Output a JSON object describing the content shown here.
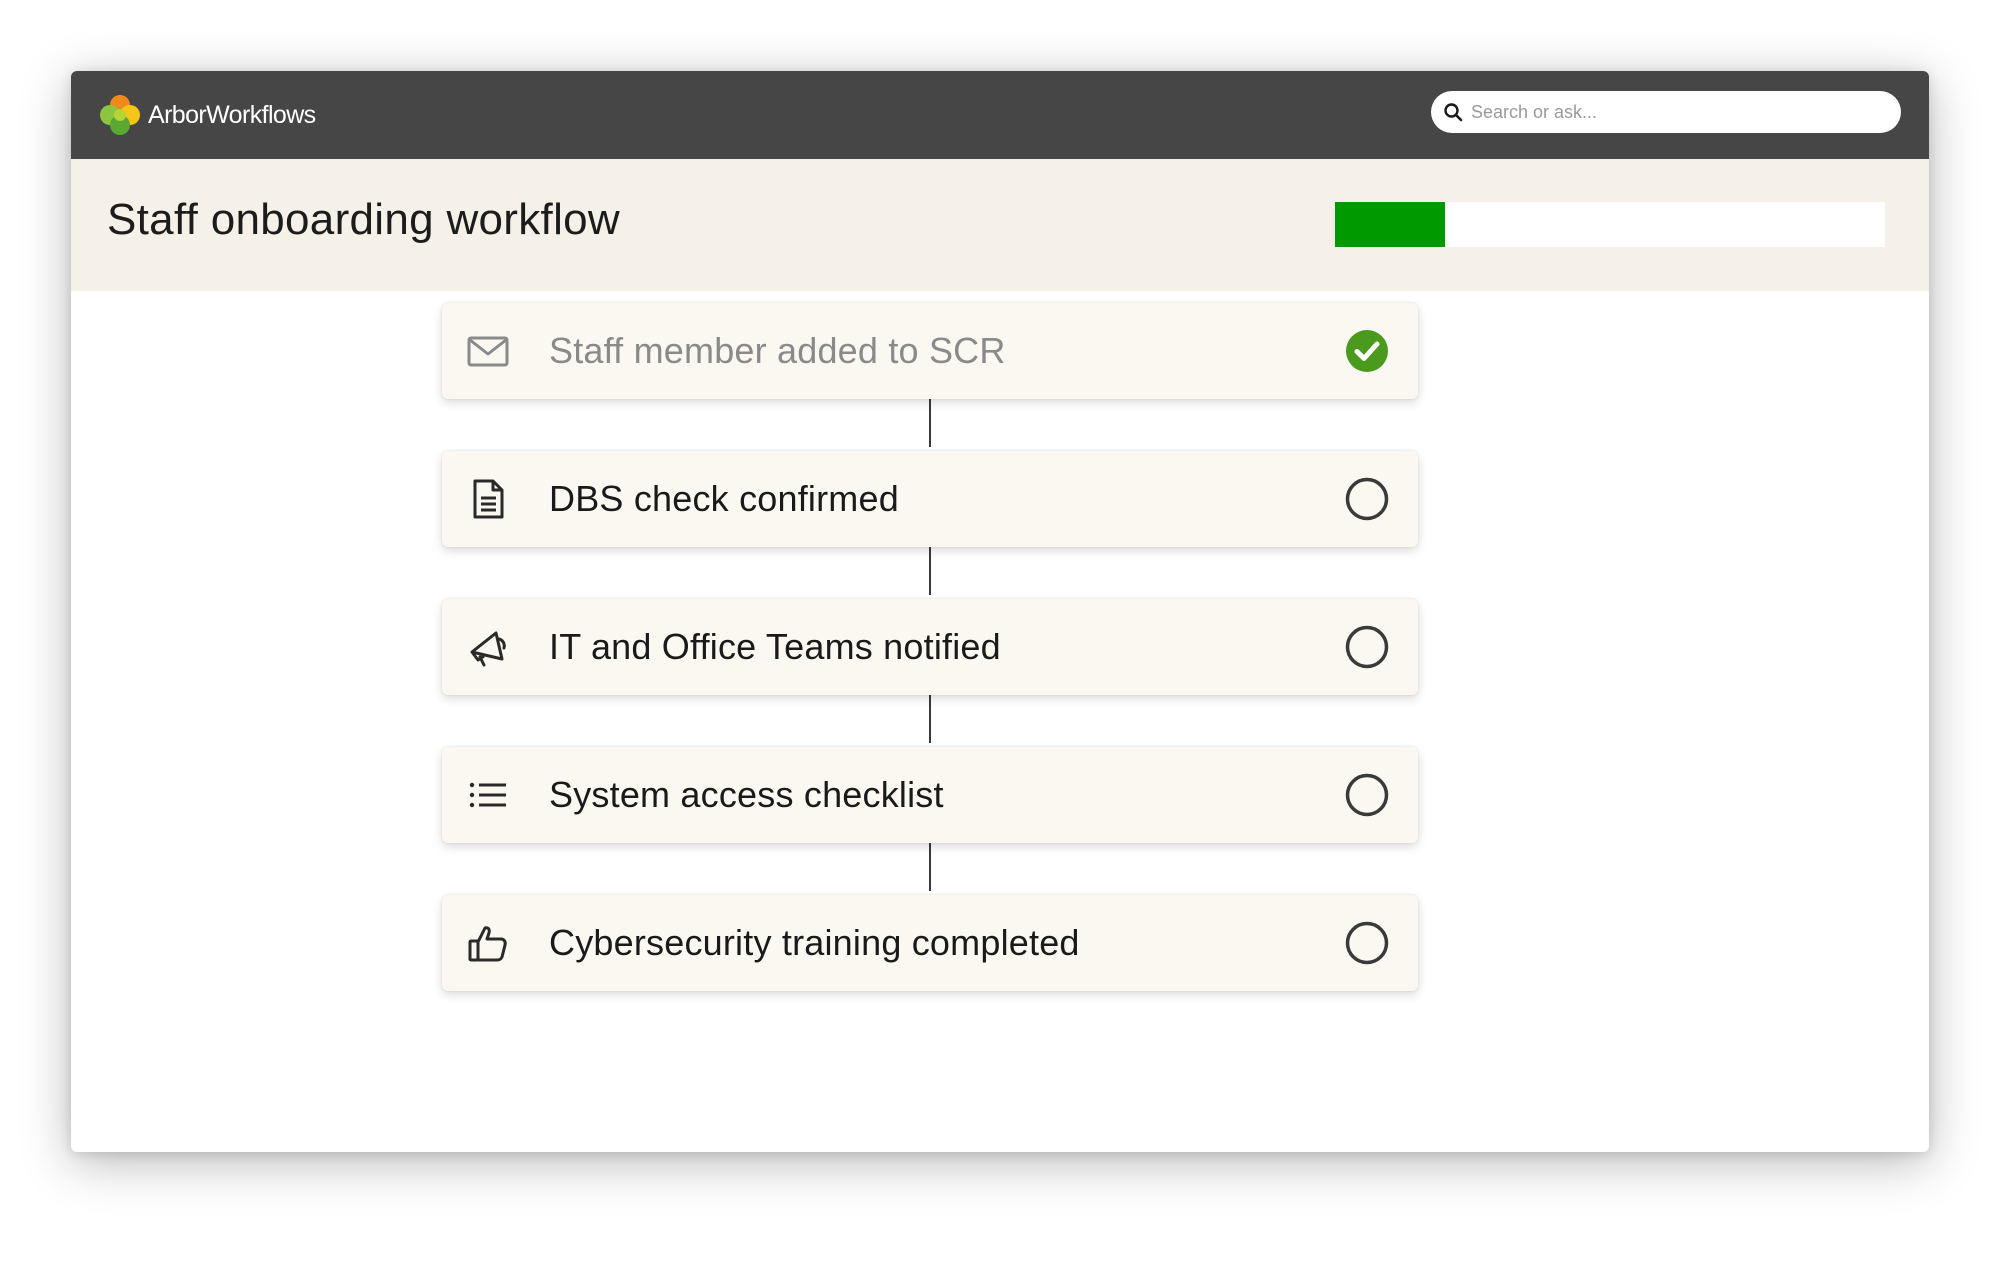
{
  "app": {
    "brand": "ArborWorkflows",
    "colors": {
      "topbar": "#464646",
      "header_bg": "#f5f0e8",
      "progress_fill": "#009a00",
      "check_green": "#4a9a1e"
    }
  },
  "search": {
    "placeholder": "Search or ask...",
    "value": "",
    "icon": "search-icon"
  },
  "page": {
    "title": "Staff onboarding workflow",
    "progress": 0.2
  },
  "steps": [
    {
      "label": "Staff member added to SCR",
      "icon": "envelope-icon",
      "status": "complete"
    },
    {
      "label": "DBS check confirmed",
      "icon": "document-icon",
      "status": "pending"
    },
    {
      "label": "IT and Office Teams notified",
      "icon": "megaphone-icon",
      "status": "pending"
    },
    {
      "label": "System access checklist",
      "icon": "list-icon",
      "status": "pending"
    },
    {
      "label": "Cybersecurity training completed",
      "icon": "thumbs-up-icon",
      "status": "pending"
    }
  ]
}
